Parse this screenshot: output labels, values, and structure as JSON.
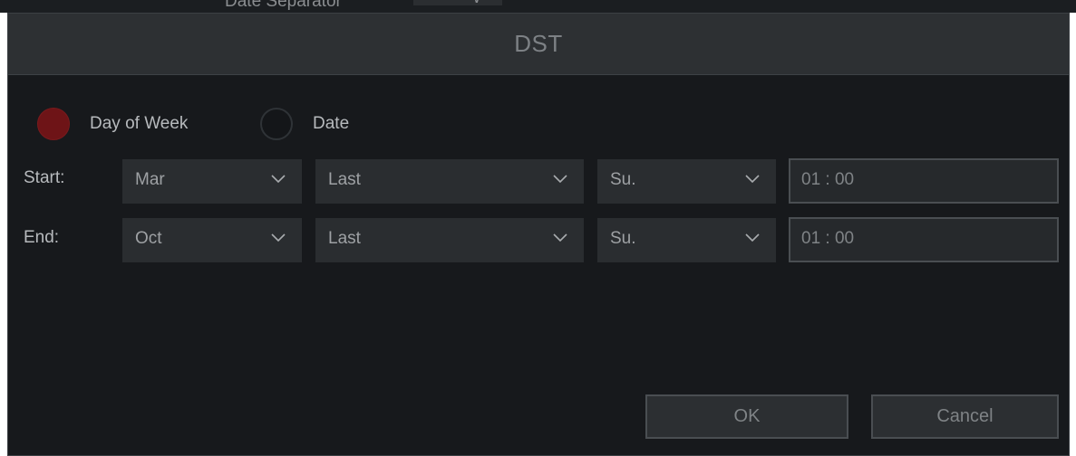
{
  "background_window": {
    "partial_label": "Date Separator"
  },
  "dialog": {
    "title": "DST",
    "mode_options": [
      {
        "label": "Day of Week",
        "selected": true
      },
      {
        "label": "Date",
        "selected": false
      }
    ],
    "start": {
      "label": "Start:",
      "month": "Mar",
      "week": "Last",
      "day": "Su.",
      "time": "01 : 00"
    },
    "end": {
      "label": "End:",
      "month": "Oct",
      "week": "Last",
      "day": "Su.",
      "time": "01 : 00"
    },
    "buttons": {
      "ok": "OK",
      "cancel": "Cancel"
    }
  },
  "colors": {
    "dialog_bg": "#17191c",
    "title_bar": "#2d3033",
    "selected_radio": "#6e1417",
    "control_bg": "#2a2d30"
  },
  "icons": [
    "chevron-down-icon",
    "radio-checked-icon",
    "radio-unchecked-icon"
  ]
}
